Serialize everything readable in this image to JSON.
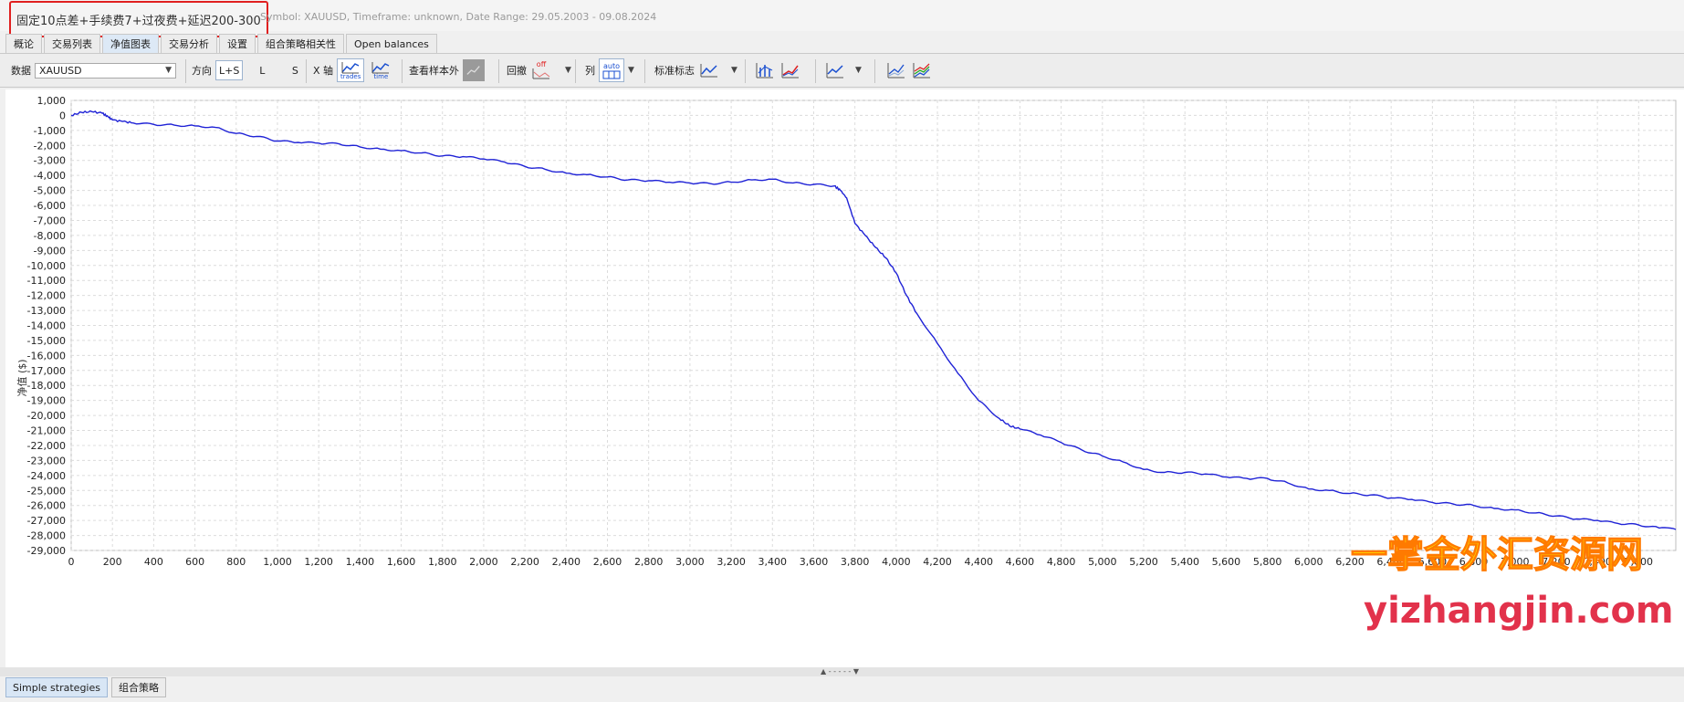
{
  "header": {
    "title": "固定10点差+手续费7+过夜费+延迟200-300",
    "meta": "Symbol: XAUUSD, Timeframe: unknown, Date Range: 29.05.2003 - 09.08.2024"
  },
  "tabs": [
    {
      "label": "概论"
    },
    {
      "label": "交易列表"
    },
    {
      "label": "净值图表"
    },
    {
      "label": "交易分析"
    },
    {
      "label": "设置"
    },
    {
      "label": "组合策略相关性"
    },
    {
      "label": "Open balances"
    }
  ],
  "toolbar": {
    "data_label": "数据",
    "data_value": "XAUUSD",
    "direction_label": "方向",
    "dir_ls": "L+S",
    "dir_l": "L",
    "dir_s": "S",
    "xaxis_label": "X 轴",
    "xaxis_trades": "trades",
    "xaxis_time": "time",
    "oos_label": "查看样本外",
    "drawdown_label": "回撤",
    "drawdown_state": "off",
    "columns_label": "列",
    "columns_state": "auto",
    "benchmark_label": "标准标志"
  },
  "chart_data": {
    "type": "line",
    "ylabel": "净值 ($)",
    "xlim": [
      0,
      7780
    ],
    "ylim": [
      -29000,
      1000
    ],
    "x_ticks": [
      0,
      200,
      400,
      600,
      800,
      1000,
      1200,
      1400,
      1600,
      1800,
      2000,
      2200,
      2400,
      2600,
      2800,
      3000,
      3200,
      3400,
      3600,
      3800,
      4000,
      4200,
      4400,
      4600,
      4800,
      5000,
      5200,
      5400,
      5600,
      5800,
      6000,
      6200,
      6400,
      6600,
      6800,
      7000,
      7200,
      7400,
      7600
    ],
    "x_tick_labels": [
      "0",
      "200",
      "400",
      "600",
      "800",
      "1,000",
      "1,200",
      "1,400",
      "1,600",
      "1,800",
      "2,000",
      "2,200",
      "2,400",
      "2,600",
      "2,800",
      "3,000",
      "3,200",
      "3,400",
      "3,600",
      "3,800",
      "4,000",
      "4,200",
      "4,400",
      "4,600",
      "4,800",
      "5,000",
      "5,200",
      "5,400",
      "5,600",
      "5,800",
      "6,000",
      "6,200",
      "6,400",
      "6,600",
      "6,800",
      "7,000",
      "7,200",
      "7,400",
      "7,600"
    ],
    "y_ticks": [
      1000,
      0,
      -1000,
      -2000,
      -3000,
      -4000,
      -5000,
      -6000,
      -7000,
      -8000,
      -9000,
      -10000,
      -11000,
      -12000,
      -13000,
      -14000,
      -15000,
      -16000,
      -17000,
      -18000,
      -19000,
      -20000,
      -21000,
      -22000,
      -23000,
      -24000,
      -25000,
      -26000,
      -27000,
      -28000,
      -29000
    ],
    "y_tick_labels": [
      "1,000",
      "0",
      "-1,000",
      "-2,000",
      "-3,000",
      "-4,000",
      "-5,000",
      "-6,000",
      "-7,000",
      "-8,000",
      "-9,000",
      "-10,000",
      "-11,000",
      "-12,000",
      "-13,000",
      "-14,000",
      "-15,000",
      "-16,000",
      "-17,000",
      "-18,000",
      "-19,000",
      "-20,000",
      "-21,000",
      "-22,000",
      "-23,000",
      "-24,000",
      "-25,000",
      "-26,000",
      "-27,000",
      "-28,000",
      "-29,000"
    ],
    "grid": true,
    "series": [
      {
        "color": "#1f22d6",
        "x": [
          0,
          50,
          100,
          150,
          180,
          200,
          250,
          300,
          400,
          500,
          600,
          700,
          800,
          900,
          1000,
          1100,
          1200,
          1300,
          1400,
          1500,
          1600,
          1700,
          1800,
          1900,
          2000,
          2100,
          2200,
          2300,
          2400,
          2500,
          2600,
          2700,
          2800,
          2900,
          3000,
          3100,
          3200,
          3300,
          3400,
          3500,
          3600,
          3700,
          3730,
          3760,
          3800,
          3850,
          3900,
          3950,
          4000,
          4050,
          4100,
          4200,
          4300,
          4400,
          4500,
          4550,
          4600,
          4700,
          4800,
          4900,
          5000,
          5100,
          5200,
          5300,
          5400,
          5500,
          5600,
          5700,
          5800,
          5900,
          6000,
          6100,
          6200,
          6300,
          6400,
          6500,
          6600,
          6700,
          6800,
          6900,
          7000,
          7100,
          7200,
          7300,
          7400,
          7500,
          7600,
          7700,
          7780
        ],
        "values": [
          0,
          200,
          250,
          150,
          -100,
          -300,
          -400,
          -500,
          -600,
          -650,
          -700,
          -800,
          -1200,
          -1400,
          -1700,
          -1800,
          -1850,
          -1900,
          -2100,
          -2250,
          -2350,
          -2500,
          -2700,
          -2750,
          -2900,
          -3100,
          -3400,
          -3600,
          -3850,
          -3950,
          -4100,
          -4300,
          -4350,
          -4450,
          -4500,
          -4550,
          -4450,
          -4300,
          -4250,
          -4500,
          -4600,
          -4700,
          -5000,
          -5500,
          -7200,
          -8000,
          -8800,
          -9500,
          -10500,
          -12000,
          -13200,
          -15200,
          -17200,
          -19000,
          -20200,
          -20700,
          -20900,
          -21300,
          -21800,
          -22300,
          -22700,
          -23100,
          -23600,
          -23800,
          -23800,
          -23900,
          -24100,
          -24200,
          -24200,
          -24500,
          -24900,
          -25000,
          -25200,
          -25300,
          -25500,
          -25600,
          -25800,
          -25900,
          -26000,
          -26200,
          -26300,
          -26500,
          -26700,
          -26900,
          -27000,
          -27200,
          -27300,
          -27500,
          -27600
        ]
      }
    ]
  },
  "watermark": {
    "line1": "一掌金外汇资源网",
    "line2": "yizhangjin.com"
  },
  "bottom_tabs": [
    {
      "label": "Simple strategies"
    },
    {
      "label": "组合策略"
    }
  ],
  "divider_mark": "▲ - - - - - ▼"
}
